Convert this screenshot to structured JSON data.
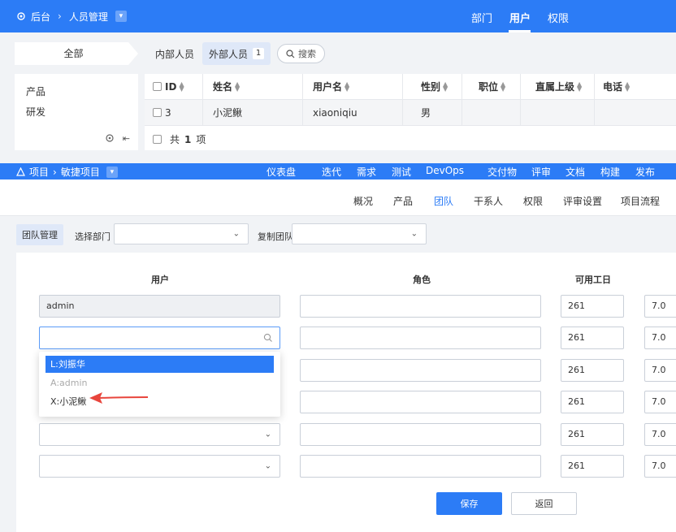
{
  "top_header": {
    "crumb_root": "后台",
    "crumb_page": "人员管理",
    "nav": [
      "部门",
      "用户",
      "权限"
    ],
    "active_nav": "用户"
  },
  "people": {
    "tab_all": "全部",
    "tab_internal": "内部人员",
    "tab_external": "外部人员",
    "external_count": "1",
    "search_label": "搜索",
    "departments": [
      "产品",
      "研发"
    ],
    "columns": [
      "ID",
      "姓名",
      "用户名",
      "性别",
      "职位",
      "直属上级",
      "电话"
    ],
    "row": {
      "id": "3",
      "name": "小泥鳅",
      "username": "xiaoniqiu",
      "gender": "男"
    },
    "footer_prefix": "共",
    "footer_count": "1",
    "footer_suffix": "项"
  },
  "project_header": {
    "crumb_root": "项目",
    "crumb_project": "敏捷项目",
    "nav": [
      "仪表盘",
      "迭代",
      "需求",
      "测试",
      "DevOps",
      "交付物",
      "评审",
      "文档",
      "构建",
      "发布"
    ]
  },
  "sub_nav": {
    "items": [
      "概况",
      "产品",
      "团队",
      "干系人",
      "权限",
      "评审设置",
      "项目流程"
    ],
    "active": "团队"
  },
  "filters": {
    "team_management": "团队管理",
    "select_dept_label": "选择部门",
    "copy_team_label": "复制团队"
  },
  "form": {
    "col_user": "用户",
    "col_role": "角色",
    "col_days": "可用工日",
    "first_user": "admin",
    "days": [
      "261",
      "261",
      "261",
      "261",
      "261",
      "261"
    ],
    "hours": [
      "7.0",
      "7.0",
      "7.0",
      "7.0",
      "7.0",
      "7.0"
    ],
    "dropdown_options": [
      "L:刘振华",
      "A:admin",
      "X:小泥鳅"
    ],
    "save": "保存",
    "back": "返回"
  },
  "colors": {
    "primary": "#2c7cf6",
    "arrow": "#e8453c"
  }
}
